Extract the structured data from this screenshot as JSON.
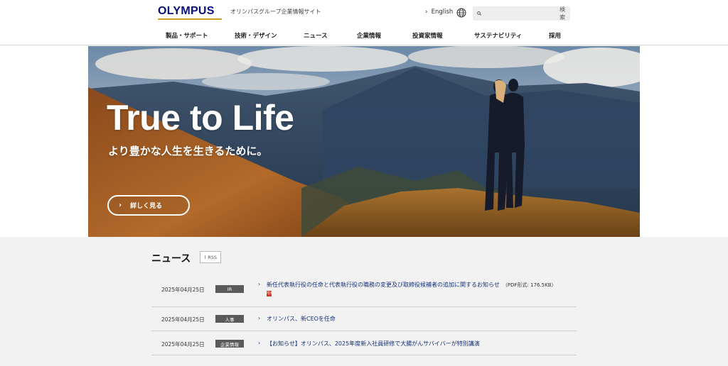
{
  "header": {
    "logo_text": "OLYMPUS",
    "tagline": "オリンパスグループ企業情報サイト",
    "language_label": "English",
    "search": {
      "placeholder": "",
      "button_label": "検索"
    }
  },
  "nav": {
    "items": [
      {
        "label": "製品・サポート"
      },
      {
        "label": "技術・デザイン"
      },
      {
        "label": "ニュース"
      },
      {
        "label": "企業情報"
      },
      {
        "label": "投資家情報"
      },
      {
        "label": "サステナビリティ"
      },
      {
        "label": "採用"
      }
    ]
  },
  "hero": {
    "title": "True to Life",
    "subtitle": "より豊かな人生を生きるために。",
    "button_label": "詳しく見る"
  },
  "news": {
    "heading": "ニュース",
    "rss_label": "RSS",
    "items": [
      {
        "date": "2025年04月25日",
        "category": "IR",
        "title": "新任代表執行役の任命と代表執行役の職務の変更及び取締役候補者の追加に関するお知らせ",
        "note": "（PDF形式: 176.5KB）",
        "pdf_label": "PDF"
      },
      {
        "date": "2025年04月25日",
        "category": "人事",
        "title": "オリンパス、新CEOを任命"
      },
      {
        "date": "2025年04月25日",
        "category": "企業情報",
        "title": "【お知らせ】オリンパス、2025年度新入社員研修で大腸がんサバイバーが特別講演"
      }
    ]
  },
  "colors": {
    "brand_blue": "#08107b",
    "brand_gold": "#c9a12a",
    "link_blue": "#14307a",
    "news_bg": "#f2f2f2"
  }
}
